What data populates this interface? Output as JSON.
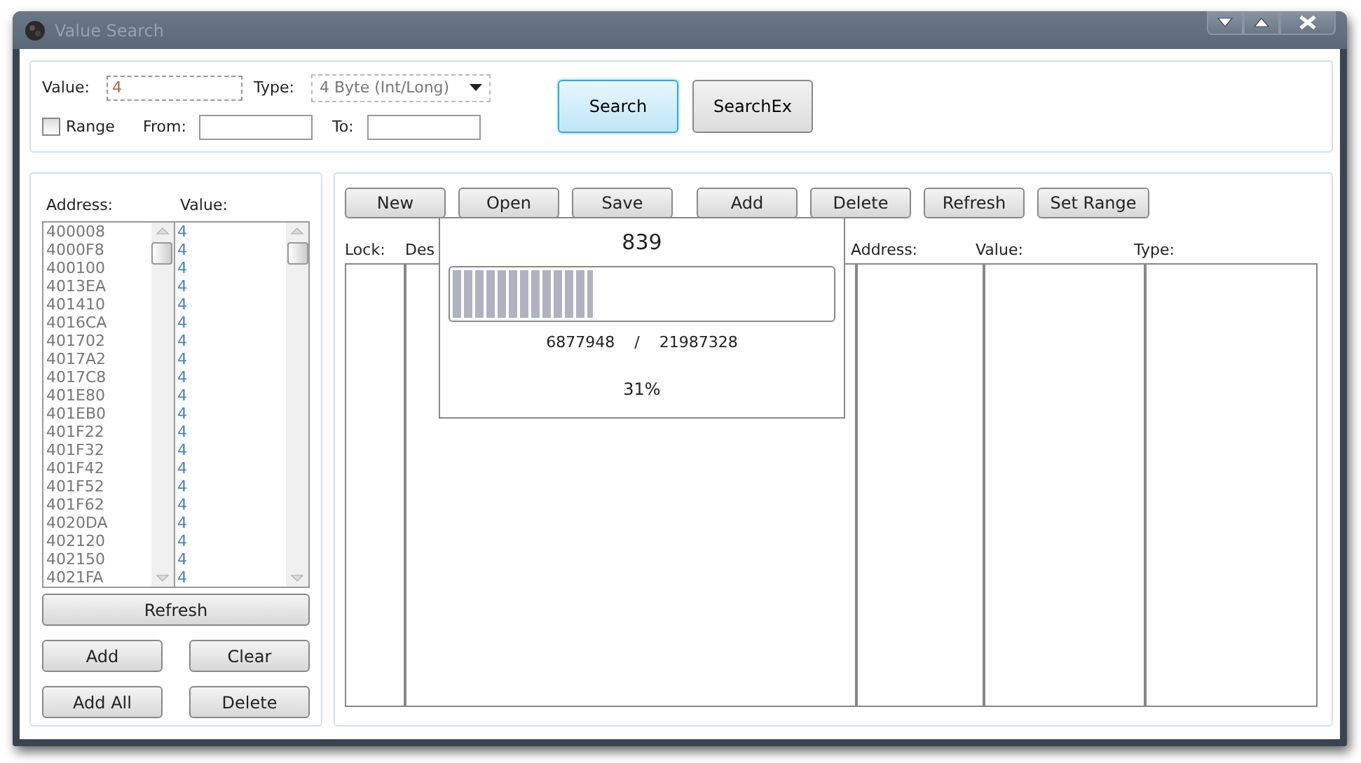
{
  "window": {
    "title": "Value Search",
    "active": false
  },
  "search": {
    "value_label": "Value:",
    "value": "4",
    "type_label": "Type:",
    "type": "4 Byte (Int/Long)",
    "range_label": "Range",
    "range_checked": false,
    "from_label": "From:",
    "to_label": "To:",
    "buttons": [
      {
        "label": "Search",
        "focused": true
      },
      {
        "label": "SearchEx",
        "focused": false
      }
    ]
  },
  "results": {
    "columns": [
      "Address:",
      "Value:"
    ],
    "rows": [
      [
        "400008",
        "4"
      ],
      [
        "4000F8",
        "4"
      ],
      [
        "400100",
        "4"
      ],
      [
        "4013EA",
        "4"
      ],
      [
        "401410",
        "4"
      ],
      [
        "4016CA",
        "4"
      ],
      [
        "401702",
        "4"
      ],
      [
        "4017A2",
        "4"
      ],
      [
        "4017C8",
        "4"
      ],
      [
        "401E80",
        "4"
      ],
      [
        "401EB0",
        "4"
      ],
      [
        "401F22",
        "4"
      ],
      [
        "401F32",
        "4"
      ],
      [
        "401F42",
        "4"
      ],
      [
        "401F52",
        "4"
      ],
      [
        "401F62",
        "4"
      ],
      [
        "4020DA",
        "4"
      ],
      [
        "402120",
        "4"
      ],
      [
        "402150",
        "4"
      ],
      [
        "4021FA",
        "4"
      ]
    ],
    "refresh": "Refresh",
    "buttons": [
      "Add",
      "Clear",
      "Add All",
      "Delete"
    ]
  },
  "list": {
    "toolbar": [
      "New",
      "Open",
      "Save",
      "Add",
      "Delete",
      "Refresh",
      "Set Range"
    ],
    "columns": [
      "Lock:",
      "Des",
      "Address:",
      "Value:",
      "Type:"
    ]
  },
  "progress": {
    "count": "839",
    "level": 0.37,
    "current": "6877948",
    "separator": "/",
    "total": "21987328",
    "percent": "31%"
  }
}
